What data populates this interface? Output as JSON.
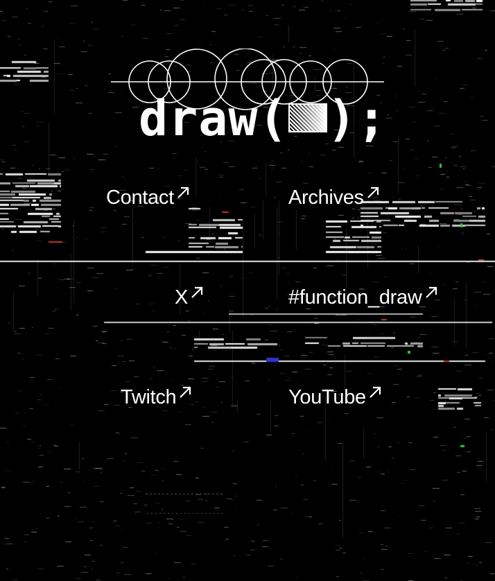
{
  "logo": {
    "prefix": "draw(",
    "suffix": ");"
  },
  "links": [
    {
      "label": "Contact"
    },
    {
      "label": "Archives"
    },
    {
      "label": "X"
    },
    {
      "label": "#function_draw"
    },
    {
      "label": "Twitch"
    },
    {
      "label": "YouTube"
    }
  ],
  "colors": {
    "background": "#000000",
    "foreground": "#ffffff",
    "glitch_red": "#c0392b",
    "glitch_green": "#2ecc40",
    "glitch_blue": "#3a2ecc"
  }
}
